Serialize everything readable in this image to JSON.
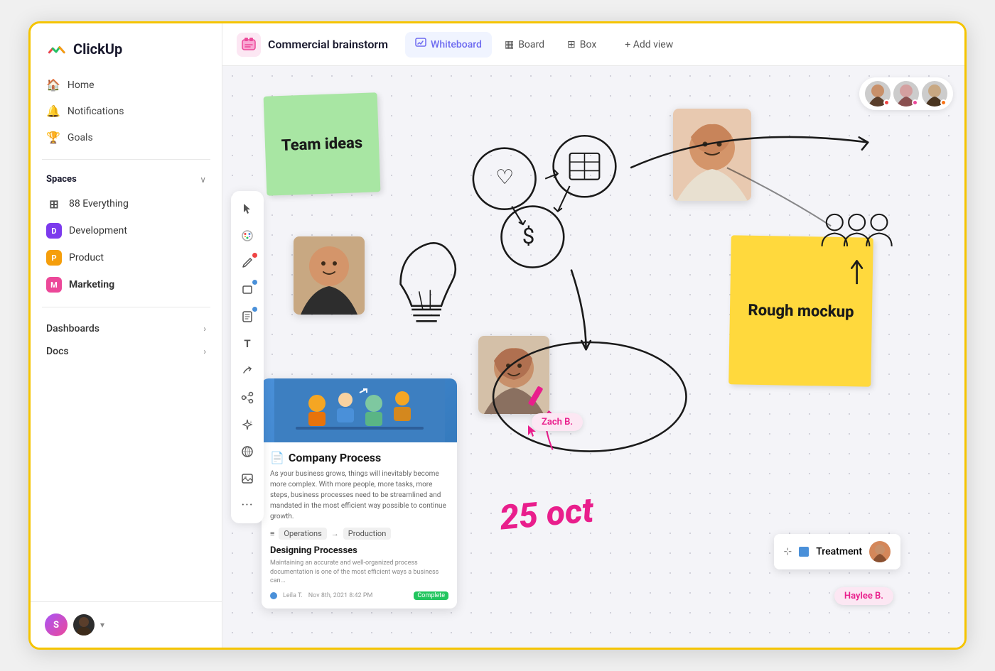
{
  "app": {
    "name": "ClickUp"
  },
  "sidebar": {
    "logo": "ClickUp",
    "nav": [
      {
        "id": "home",
        "label": "Home",
        "icon": "🏠"
      },
      {
        "id": "notifications",
        "label": "Notifications",
        "icon": "🔔"
      },
      {
        "id": "goals",
        "label": "Goals",
        "icon": "🏆"
      }
    ],
    "spaces_label": "Spaces",
    "spaces": [
      {
        "id": "everything",
        "label": "Everything",
        "badge_text": "⊞",
        "color": ""
      },
      {
        "id": "development",
        "label": "Development",
        "badge_text": "D",
        "color": "#7c3aed"
      },
      {
        "id": "product",
        "label": "Product",
        "badge_text": "P",
        "color": "#f59e0b"
      },
      {
        "id": "marketing",
        "label": "Marketing",
        "badge_text": "M",
        "color": "#ec4899"
      }
    ],
    "everything_count": "88",
    "sections": [
      {
        "id": "dashboards",
        "label": "Dashboards"
      },
      {
        "id": "docs",
        "label": "Docs"
      }
    ],
    "bottom_chevron": "▾"
  },
  "header": {
    "project_icon": "📦",
    "title": "Commercial brainstorm",
    "tabs": [
      {
        "id": "whiteboard",
        "label": "Whiteboard",
        "icon": "✏️",
        "active": true
      },
      {
        "id": "board",
        "label": "Board",
        "icon": "▦"
      },
      {
        "id": "box",
        "label": "Box",
        "icon": "⊞"
      }
    ],
    "add_view": "+ Add view"
  },
  "whiteboard": {
    "sticky_green": "Team ideas",
    "sticky_yellow": "Rough mockup",
    "doc_card": {
      "title": "Company Process",
      "description": "As your business grows, things will inevitably become more complex. With more people, more tasks, more steps, business processes need to be streamlined and mandated in the most efficient way possible to continue growth.",
      "flow_from": "Operations",
      "flow_to": "Production",
      "subtitle": "Designing Processes",
      "subtext": "Maintaining an accurate and well-organized process documentation is one of the most efficient ways a business can...",
      "footer_name": "Leila T.",
      "footer_date": "Nov 8th, 2021  8:42 PM",
      "footer_status": "Complete"
    },
    "treatment_label": "Treatment",
    "collaborators": [
      {
        "name": "user1",
        "dot_color": "dot-red"
      },
      {
        "name": "user2",
        "dot_color": "dot-pink"
      },
      {
        "name": "user3",
        "dot_color": "dot-orange"
      }
    ],
    "zach_badge": "Zach B.",
    "haylee_badge": "Haylee B.",
    "oct_text": "25 oct"
  },
  "toolbar": {
    "tools": [
      {
        "id": "select",
        "icon": "⬆",
        "label": "Select"
      },
      {
        "id": "palette",
        "icon": "🎨",
        "label": "Palette"
      },
      {
        "id": "pen",
        "icon": "✏",
        "label": "Pen",
        "has_dot": true,
        "dot_color": "#ef4444"
      },
      {
        "id": "rectangle",
        "icon": "▭",
        "label": "Rectangle",
        "has_dot": true,
        "dot_color": "#4a90d9"
      },
      {
        "id": "note",
        "icon": "🗒",
        "label": "Note",
        "has_dot": true,
        "dot_color": "#4a90d9"
      },
      {
        "id": "text",
        "icon": "T",
        "label": "Text"
      },
      {
        "id": "line",
        "icon": "⤴",
        "label": "Line"
      },
      {
        "id": "connect",
        "icon": "⑂",
        "label": "Connect"
      },
      {
        "id": "sparkle",
        "icon": "✦",
        "label": "Sparkle"
      },
      {
        "id": "globe",
        "icon": "🌐",
        "label": "Globe"
      },
      {
        "id": "image",
        "icon": "🖼",
        "label": "Image"
      },
      {
        "id": "more",
        "icon": "…",
        "label": "More"
      }
    ]
  }
}
